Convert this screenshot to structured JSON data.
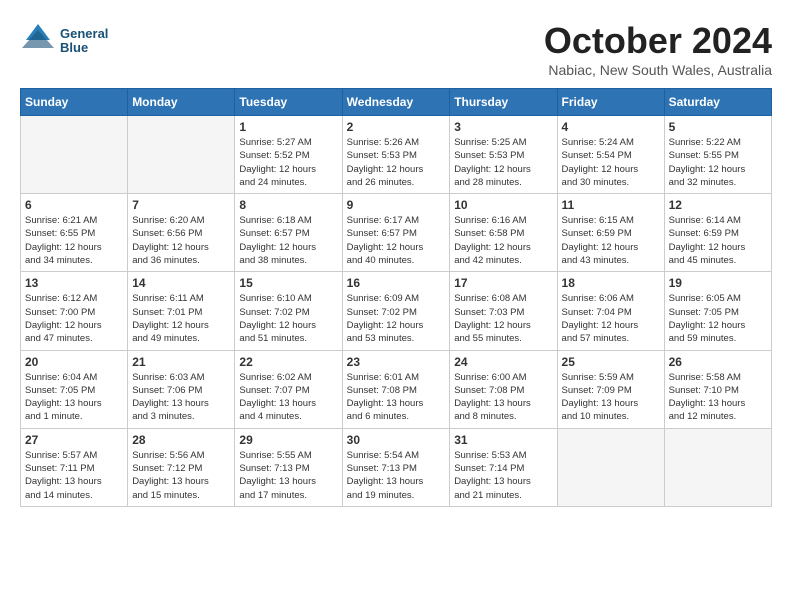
{
  "logo": {
    "line1": "General",
    "line2": "Blue"
  },
  "title": "October 2024",
  "subtitle": "Nabiac, New South Wales, Australia",
  "headers": [
    "Sunday",
    "Monday",
    "Tuesday",
    "Wednesday",
    "Thursday",
    "Friday",
    "Saturday"
  ],
  "weeks": [
    [
      {
        "num": "",
        "info": ""
      },
      {
        "num": "",
        "info": ""
      },
      {
        "num": "1",
        "info": "Sunrise: 5:27 AM\nSunset: 5:52 PM\nDaylight: 12 hours\nand 24 minutes."
      },
      {
        "num": "2",
        "info": "Sunrise: 5:26 AM\nSunset: 5:53 PM\nDaylight: 12 hours\nand 26 minutes."
      },
      {
        "num": "3",
        "info": "Sunrise: 5:25 AM\nSunset: 5:53 PM\nDaylight: 12 hours\nand 28 minutes."
      },
      {
        "num": "4",
        "info": "Sunrise: 5:24 AM\nSunset: 5:54 PM\nDaylight: 12 hours\nand 30 minutes."
      },
      {
        "num": "5",
        "info": "Sunrise: 5:22 AM\nSunset: 5:55 PM\nDaylight: 12 hours\nand 32 minutes."
      }
    ],
    [
      {
        "num": "6",
        "info": "Sunrise: 6:21 AM\nSunset: 6:55 PM\nDaylight: 12 hours\nand 34 minutes."
      },
      {
        "num": "7",
        "info": "Sunrise: 6:20 AM\nSunset: 6:56 PM\nDaylight: 12 hours\nand 36 minutes."
      },
      {
        "num": "8",
        "info": "Sunrise: 6:18 AM\nSunset: 6:57 PM\nDaylight: 12 hours\nand 38 minutes."
      },
      {
        "num": "9",
        "info": "Sunrise: 6:17 AM\nSunset: 6:57 PM\nDaylight: 12 hours\nand 40 minutes."
      },
      {
        "num": "10",
        "info": "Sunrise: 6:16 AM\nSunset: 6:58 PM\nDaylight: 12 hours\nand 42 minutes."
      },
      {
        "num": "11",
        "info": "Sunrise: 6:15 AM\nSunset: 6:59 PM\nDaylight: 12 hours\nand 43 minutes."
      },
      {
        "num": "12",
        "info": "Sunrise: 6:14 AM\nSunset: 6:59 PM\nDaylight: 12 hours\nand 45 minutes."
      }
    ],
    [
      {
        "num": "13",
        "info": "Sunrise: 6:12 AM\nSunset: 7:00 PM\nDaylight: 12 hours\nand 47 minutes."
      },
      {
        "num": "14",
        "info": "Sunrise: 6:11 AM\nSunset: 7:01 PM\nDaylight: 12 hours\nand 49 minutes."
      },
      {
        "num": "15",
        "info": "Sunrise: 6:10 AM\nSunset: 7:02 PM\nDaylight: 12 hours\nand 51 minutes."
      },
      {
        "num": "16",
        "info": "Sunrise: 6:09 AM\nSunset: 7:02 PM\nDaylight: 12 hours\nand 53 minutes."
      },
      {
        "num": "17",
        "info": "Sunrise: 6:08 AM\nSunset: 7:03 PM\nDaylight: 12 hours\nand 55 minutes."
      },
      {
        "num": "18",
        "info": "Sunrise: 6:06 AM\nSunset: 7:04 PM\nDaylight: 12 hours\nand 57 minutes."
      },
      {
        "num": "19",
        "info": "Sunrise: 6:05 AM\nSunset: 7:05 PM\nDaylight: 12 hours\nand 59 minutes."
      }
    ],
    [
      {
        "num": "20",
        "info": "Sunrise: 6:04 AM\nSunset: 7:05 PM\nDaylight: 13 hours\nand 1 minute."
      },
      {
        "num": "21",
        "info": "Sunrise: 6:03 AM\nSunset: 7:06 PM\nDaylight: 13 hours\nand 3 minutes."
      },
      {
        "num": "22",
        "info": "Sunrise: 6:02 AM\nSunset: 7:07 PM\nDaylight: 13 hours\nand 4 minutes."
      },
      {
        "num": "23",
        "info": "Sunrise: 6:01 AM\nSunset: 7:08 PM\nDaylight: 13 hours\nand 6 minutes."
      },
      {
        "num": "24",
        "info": "Sunrise: 6:00 AM\nSunset: 7:08 PM\nDaylight: 13 hours\nand 8 minutes."
      },
      {
        "num": "25",
        "info": "Sunrise: 5:59 AM\nSunset: 7:09 PM\nDaylight: 13 hours\nand 10 minutes."
      },
      {
        "num": "26",
        "info": "Sunrise: 5:58 AM\nSunset: 7:10 PM\nDaylight: 13 hours\nand 12 minutes."
      }
    ],
    [
      {
        "num": "27",
        "info": "Sunrise: 5:57 AM\nSunset: 7:11 PM\nDaylight: 13 hours\nand 14 minutes."
      },
      {
        "num": "28",
        "info": "Sunrise: 5:56 AM\nSunset: 7:12 PM\nDaylight: 13 hours\nand 15 minutes."
      },
      {
        "num": "29",
        "info": "Sunrise: 5:55 AM\nSunset: 7:13 PM\nDaylight: 13 hours\nand 17 minutes."
      },
      {
        "num": "30",
        "info": "Sunrise: 5:54 AM\nSunset: 7:13 PM\nDaylight: 13 hours\nand 19 minutes."
      },
      {
        "num": "31",
        "info": "Sunrise: 5:53 AM\nSunset: 7:14 PM\nDaylight: 13 hours\nand 21 minutes."
      },
      {
        "num": "",
        "info": ""
      },
      {
        "num": "",
        "info": ""
      }
    ]
  ]
}
